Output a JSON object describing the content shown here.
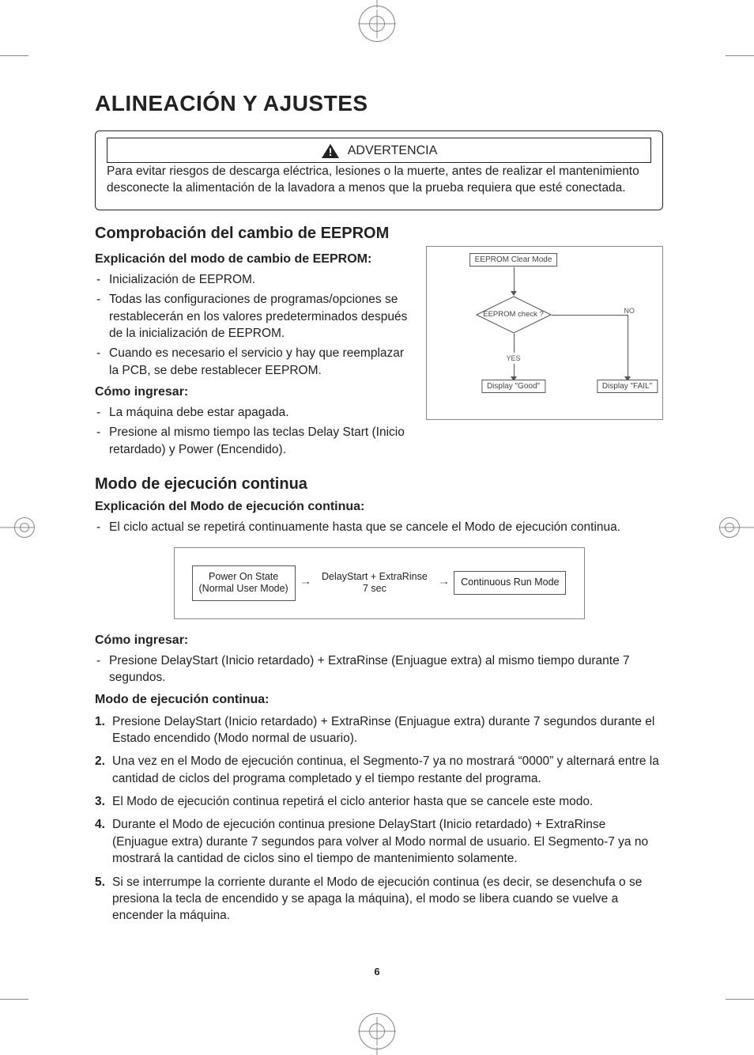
{
  "page_number": "6",
  "title": "ALINEACIÓN Y AJUSTES",
  "warning": {
    "heading": "ADVERTENCIA",
    "body": "Para evitar riesgos de descarga eléctrica, lesiones o la muerte, antes de realizar el mantenimiento desconecte la alimentación de la lavadora a menos que la prueba requiera que esté conectada."
  },
  "eeprom": {
    "heading": "Comprobación del cambio de EEPROM",
    "explain_label": "Explicación del modo de cambio de EEPROM:",
    "explain_items": [
      "Inicialización de EEPROM.",
      "Todas las configuraciones de programas/opciones se restablecerán en los valores predeterminados después de la inicialización de EEPROM.",
      "Cuando es necesario el servicio y hay que reemplazar la PCB, se debe restablecer EEPROM."
    ],
    "enter_label": "Cómo ingresar:",
    "enter_items": [
      "La máquina debe estar apagada.",
      "Presione al mismo tiempo las teclas Delay Start (Inicio retardado) y Power (Encendido)."
    ],
    "flow": {
      "start": "EEPROM Clear Mode",
      "decision": "EEPROM check ?",
      "yes_label": "YES",
      "no_label": "NO",
      "result_good": "Display \"Good\"",
      "result_fail": "Display \"FAIL\""
    }
  },
  "continuous": {
    "heading": "Modo de ejecución continua",
    "explain_label": "Explicación del Modo de ejecución continua:",
    "explain_items": [
      "El ciclo actual se repetirá continuamente hasta que se cancele el Modo de ejecución continua."
    ],
    "flow": {
      "box_left_l1": "Power On State",
      "box_left_l2": "(Normal User Mode)",
      "mid_l1": "DelayStart + ExtraRinse",
      "mid_l2": "7 sec",
      "box_right": "Continuous Run Mode"
    },
    "enter_label": "Cómo ingresar:",
    "enter_items": [
      "Presione DelayStart (Inicio retardado) + ExtraRinse (Enjuague extra) al mismo tiempo durante 7 segundos."
    ],
    "steps_label": "Modo de ejecución continua:",
    "steps": [
      "Presione DelayStart (Inicio retardado) + ExtraRinse (Enjuague extra) durante 7 segundos durante el Estado encendido (Modo normal de usuario).",
      "Una vez en el Modo de ejecución continua, el Segmento-7 ya no mostrará “0000” y alternará entre la cantidad de ciclos del programa completado y el tiempo restante del programa.",
      "El Modo de ejecución continua repetirá el ciclo anterior hasta que se cancele este modo.",
      "Durante el Modo de ejecución continua presione DelayStart (Inicio retardado) + ExtraRinse (Enjuague extra) durante 7 segundos para volver al Modo normal de usuario. El Segmento-7 ya no mostrará la cantidad de ciclos sino el tiempo de mantenimiento solamente.",
      "Si se interrumpe la corriente durante el Modo de ejecución continua (es decir, se desenchufa o se presiona la tecla de encendido y se apaga la máquina), el modo se libera cuando se vuelve a encender la máquina."
    ]
  }
}
